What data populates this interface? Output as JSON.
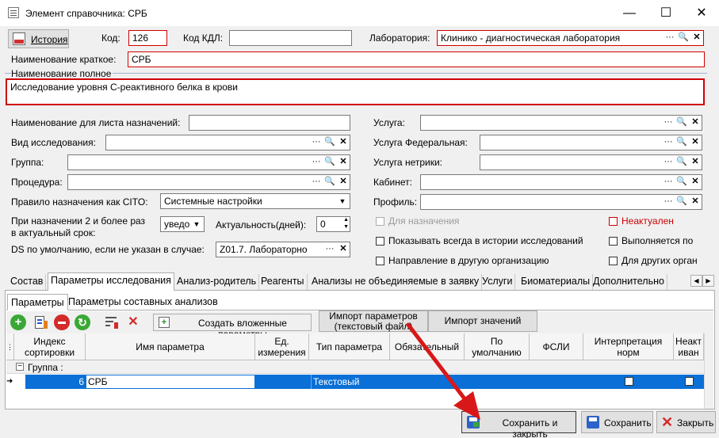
{
  "window": {
    "title": "Элемент справочника: СРБ",
    "minimize": "—",
    "maximize": "☐",
    "close": "✕"
  },
  "header": {
    "history_label": "История",
    "code_label": "Код:",
    "code_value": "126",
    "kdl_label": "Код КДЛ:",
    "kdl_value": "",
    "lab_label": "Лаборатория:",
    "lab_value": "Клинико - диагностическая лаборатория",
    "short_name_label": "Наименование краткое:",
    "short_name_value": "СРБ",
    "full_name_label": "Наименование полное",
    "full_name_value": "Исследование уровня С-реактивного белка в крови"
  },
  "left_fields": {
    "list_name_label": "Наименование для листа назначений:",
    "list_name_value": "",
    "research_type_label": "Вид исследования:",
    "research_type_value": "",
    "group_label": "Группа:",
    "group_value": "",
    "procedure_label": "Процедура:",
    "procedure_value": "",
    "cito_label": "Правило назначения как CITO:",
    "cito_value": "Системные настройки",
    "repeat_label_1": "При назначении 2 и более раз",
    "repeat_label_2": "в актуальный срок:",
    "repeat_value": "уведо",
    "actuality_label": "Актуальность(дней):",
    "actuality_value": "0",
    "ds_label": "DS по умолчанию, если не указан в случае:",
    "ds_value": "Z01.7. Лабораторно"
  },
  "right_fields": {
    "service_label": "Услуга:",
    "service_value": "",
    "service_fed_label": "Услуга Федеральная:",
    "service_fed_value": "",
    "service_metric_label": "Услуга нетрики:",
    "service_metric_value": "",
    "cabinet_label": "Кабинет:",
    "cabinet_value": "",
    "profile_label": "Профиль:",
    "profile_value": ""
  },
  "checkboxes": {
    "for_assign": "Для назначения",
    "not_actual": "Неактуален",
    "show_history": "Показывать всегда в истории исследований",
    "performed_by": "Выполняется по",
    "other_org_direction": "Направление в другую организацию",
    "for_other_orgs": "Для других орган"
  },
  "tabs": [
    "Состав",
    "Параметры исследования",
    "Анализ-родитель",
    "Реагенты",
    "Анализы не объединяемые в заявку",
    "Услуги",
    "Биоматериалы",
    "Дополнительно"
  ],
  "subtabs": [
    "Параметры",
    "Параметры составных анализов"
  ],
  "toolbar": {
    "create_nested": "Создать вложенные параметры",
    "import_params": "Импорт параметров (текстовый файл)",
    "import_values": "Импорт значений"
  },
  "grid": {
    "columns": [
      "Индекс сортировки",
      "Имя параметра",
      "Ед. измерения",
      "Тип параметра",
      "Обязательный",
      "По умолчанию",
      "ФСЛИ",
      "Интерпретация норм",
      "Неакт иван"
    ],
    "group_label": "Группа :",
    "rows": [
      {
        "index": "6",
        "name": "СРБ",
        "unit": "",
        "type": "Текстовый"
      }
    ]
  },
  "footer": {
    "save_close": "Сохранить и закрыть",
    "save": "Сохранить",
    "close": "Закрыть"
  },
  "colors": {
    "selection": "#0a6fd6",
    "arrow": "#d81818",
    "required_border": "#d00000"
  }
}
